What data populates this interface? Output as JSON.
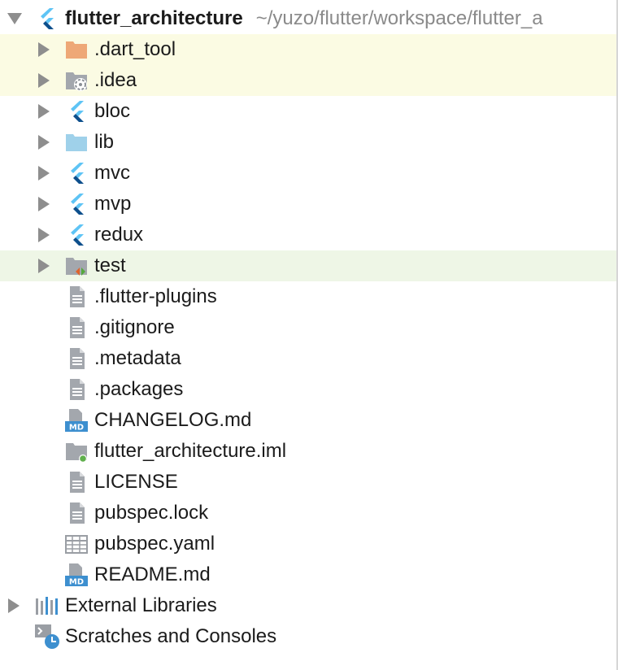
{
  "project": {
    "name": "flutter_architecture",
    "path": "~/yuzo/flutter/workspace/flutter_a"
  },
  "items": [
    {
      "label": ".dart_tool",
      "icon": "folder-orange-icon"
    },
    {
      "label": ".idea",
      "icon": "idea-folder-icon"
    },
    {
      "label": "bloc",
      "icon": "flutter-module-icon"
    },
    {
      "label": "lib",
      "icon": "source-folder-icon"
    },
    {
      "label": "mvc",
      "icon": "flutter-module-icon"
    },
    {
      "label": "mvp",
      "icon": "flutter-module-icon"
    },
    {
      "label": "redux",
      "icon": "flutter-module-icon"
    },
    {
      "label": "test",
      "icon": "test-folder-icon"
    },
    {
      "label": ".flutter-plugins",
      "icon": "text-file-icon"
    },
    {
      "label": ".gitignore",
      "icon": "text-file-icon"
    },
    {
      "label": ".metadata",
      "icon": "text-file-icon"
    },
    {
      "label": ".packages",
      "icon": "text-file-icon"
    },
    {
      "label": "CHANGELOG.md",
      "icon": "markdown-file-icon"
    },
    {
      "label": "flutter_architecture.iml",
      "icon": "iml-file-icon"
    },
    {
      "label": "LICENSE",
      "icon": "text-file-icon"
    },
    {
      "label": "pubspec.lock",
      "icon": "text-file-icon"
    },
    {
      "label": "pubspec.yaml",
      "icon": "yaml-file-icon"
    },
    {
      "label": "README.md",
      "icon": "markdown-file-icon"
    }
  ],
  "external_libraries": {
    "label": "External Libraries",
    "icon": "libraries-icon"
  },
  "scratches": {
    "label": "Scratches and Consoles",
    "icon": "scratches-icon"
  },
  "colors": {
    "highlight_yellow": "#fbfbe3",
    "highlight_green": "#eef6e6",
    "flutter_light": "#5ec4f5",
    "flutter_dark": "#0d4f8c",
    "folder_orange": "#eea877",
    "folder_blue": "#9fd1ea",
    "folder_gray": "#a3a7ad"
  }
}
